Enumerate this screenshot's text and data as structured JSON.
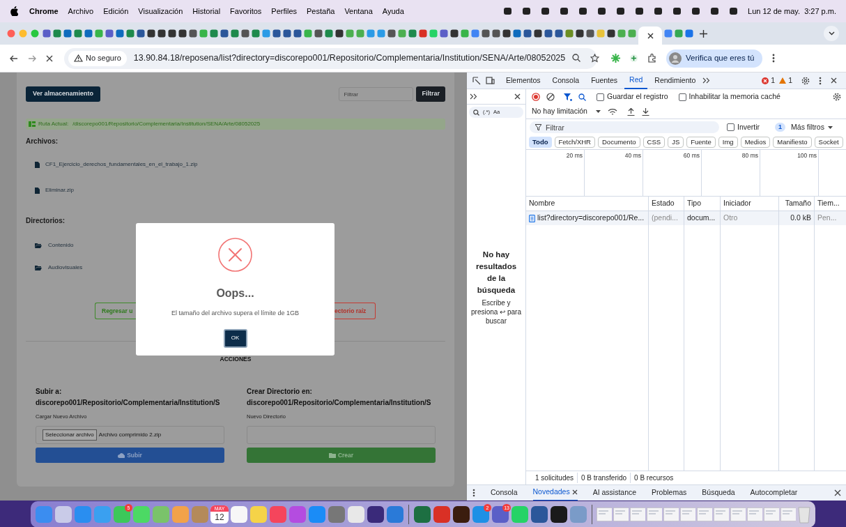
{
  "menu_bar": {
    "app": "Chrome",
    "items": [
      "Archivo",
      "Edición",
      "Visualización",
      "Historial",
      "Favoritos",
      "Perfiles",
      "Pestaña",
      "Ventana",
      "Ayuda"
    ],
    "clock": "Lun 12 de may.  3:27 p.m."
  },
  "address_bar": {
    "security": "No seguro",
    "url": "13.90.84.18/reposena/list?directory=discorepo001/Repositorio/Complementaria/Institution/SENA/Arte/08052025",
    "profile_button": "Verifica que eres tú"
  },
  "page": {
    "storage_button": "Ver almacenamiento",
    "filter": {
      "placeholder": "Filtrar"
    },
    "filter_button": "Filtrar",
    "current_path": {
      "label": "Ruta Actual:",
      "value": "/discorepo001/Repositorio/Complementaria/Institution/SENA/Arte/08052025"
    },
    "files_heading": "Archivos:",
    "files": [
      "CF1_Ejercicio_derechos_fundamentales_en_el_trabajo_1.zip",
      "Eliminar.zip"
    ],
    "directories_heading": "Directorios:",
    "directories": [
      "Contenido",
      "Audiovisuales"
    ],
    "back_button": "Regresar u",
    "root_button": "ectorio raíz",
    "actions_heading": "ACCIONES",
    "upload": {
      "heading": "Subir a:",
      "path": "discorepo001/Repositorio/Complementaria/Institution/S",
      "label": "Cargar Nuevo Archivo",
      "choose_button": "Seleccionar archivo",
      "file_name": "Archivo comprimido 2.zip",
      "submit": "Subir"
    },
    "create": {
      "heading": "Crear Directorio en:",
      "path": "discorepo001/Repositorio/Complementaria/Institution/S",
      "label": "Nuevo Directorio",
      "submit": "Crear"
    }
  },
  "dialog": {
    "title": "Oops...",
    "message": "El tamaño del archivo supera el límite de 1GB",
    "button": "OK"
  },
  "devtools": {
    "tabs": [
      {
        "label": "Elementos",
        "selected": false
      },
      {
        "label": "Consola",
        "selected": false
      },
      {
        "label": "Fuentes",
        "selected": false
      },
      {
        "label": "Red",
        "selected": true
      },
      {
        "label": "Rendimiento",
        "selected": false
      }
    ],
    "errors": "1",
    "warnings": "1",
    "sidebar": {
      "search_options": [
        "(.*)",
        "Aa"
      ],
      "empty_title": "No hay resultados de la búsqueda",
      "empty_hint": "Escribe y presiona ↩ para buscar"
    },
    "network": {
      "preserve_log": {
        "label": "Guardar el registro",
        "checked": false
      },
      "disable_cache": {
        "label": "Inhabilitar la memoria caché",
        "checked": false
      },
      "throttling": "No hay limitación",
      "filter": {
        "placeholder": "Filtrar"
      },
      "invert": {
        "label": "Invertir",
        "checked": false
      },
      "more_filters_count": "1",
      "more_filters": "Más filtros",
      "type_filters": [
        {
          "label": "Todo",
          "selected": true
        },
        {
          "label": "Fetch/XHR",
          "selected": false
        },
        {
          "label": "Documento",
          "selected": false
        },
        {
          "label": "CSS",
          "selected": false
        },
        {
          "label": "JS",
          "selected": false
        },
        {
          "label": "Fuente",
          "selected": false
        },
        {
          "label": "Img",
          "selected": false
        },
        {
          "label": "Medios",
          "selected": false
        },
        {
          "label": "Manifiesto",
          "selected": false
        },
        {
          "label": "Socket",
          "selected": false
        }
      ],
      "timeline_ticks": [
        "20 ms",
        "40 ms",
        "60 ms",
        "80 ms",
        "100 ms"
      ],
      "columns": [
        "Nombre",
        "Estado",
        "Tipo",
        "Iniciador",
        "Tamaño",
        "Tiem..."
      ],
      "rows": [
        {
          "cells": [
            "list?directory=discorepo001/Re...",
            "(pendi...",
            "docum...",
            "Otro",
            "0.0 kB",
            "Pen..."
          ]
        }
      ],
      "summary": [
        "1 solicitudes",
        "0 B transferido",
        "0 B recursos"
      ]
    },
    "drawer_tabs": [
      {
        "label": "Consola",
        "selected": false
      },
      {
        "label": "Novedades",
        "selected": true
      },
      {
        "label": "AI assistance",
        "selected": false
      },
      {
        "label": "Problemas",
        "selected": false
      },
      {
        "label": "Búsqueda",
        "selected": false
      },
      {
        "label": "Autocompletar",
        "selected": false
      }
    ]
  },
  "dock": [
    {
      "kind": "app"
    },
    {
      "kind": "app"
    },
    {
      "kind": "app"
    },
    {
      "kind": "app"
    },
    {
      "kind": "app",
      "badge": "5"
    },
    {
      "kind": "app"
    },
    {
      "kind": "app"
    },
    {
      "kind": "app"
    },
    {
      "kind": "app"
    },
    {
      "kind": "calendar",
      "month": "MAY",
      "day": "12"
    },
    {
      "kind": "app"
    },
    {
      "kind": "app"
    },
    {
      "kind": "app"
    },
    {
      "kind": "app"
    },
    {
      "kind": "app"
    },
    {
      "kind": "app"
    },
    {
      "kind": "app"
    },
    {
      "kind": "app"
    },
    {
      "kind": "app"
    },
    {
      "kind": "separator"
    },
    {
      "kind": "app"
    },
    {
      "kind": "app"
    },
    {
      "kind": "app"
    },
    {
      "kind": "app",
      "badge": "2"
    },
    {
      "kind": "app",
      "badge": "13"
    },
    {
      "kind": "app"
    },
    {
      "kind": "app"
    },
    {
      "kind": "app"
    },
    {
      "kind": "app"
    },
    {
      "kind": "separator"
    },
    {
      "kind": "window"
    },
    {
      "kind": "window"
    },
    {
      "kind": "window"
    },
    {
      "kind": "window"
    },
    {
      "kind": "window"
    },
    {
      "kind": "window"
    },
    {
      "kind": "window"
    },
    {
      "kind": "window"
    },
    {
      "kind": "window"
    },
    {
      "kind": "window"
    },
    {
      "kind": "window"
    },
    {
      "kind": "window"
    },
    {
      "kind": "trash"
    }
  ]
}
